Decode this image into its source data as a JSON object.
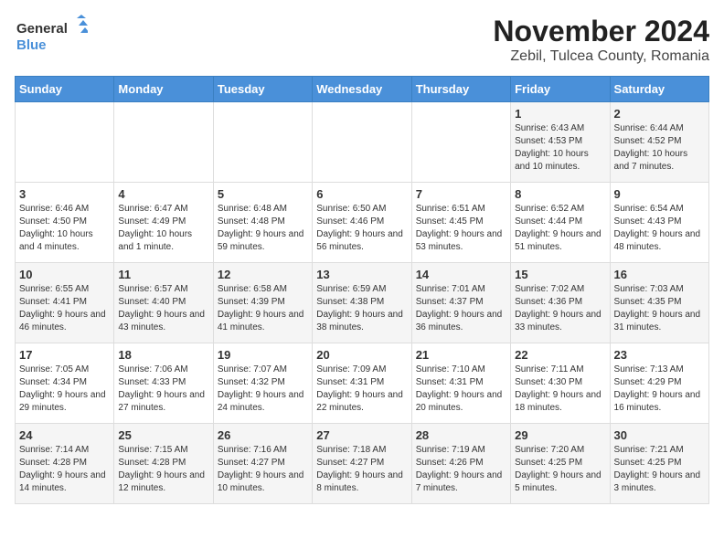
{
  "header": {
    "logo_line1": "General",
    "logo_line2": "Blue",
    "title": "November 2024",
    "subtitle": "Zebil, Tulcea County, Romania"
  },
  "weekdays": [
    "Sunday",
    "Monday",
    "Tuesday",
    "Wednesday",
    "Thursday",
    "Friday",
    "Saturday"
  ],
  "weeks": [
    [
      {
        "day": "",
        "info": ""
      },
      {
        "day": "",
        "info": ""
      },
      {
        "day": "",
        "info": ""
      },
      {
        "day": "",
        "info": ""
      },
      {
        "day": "",
        "info": ""
      },
      {
        "day": "1",
        "info": "Sunrise: 6:43 AM\nSunset: 4:53 PM\nDaylight: 10 hours and 10 minutes."
      },
      {
        "day": "2",
        "info": "Sunrise: 6:44 AM\nSunset: 4:52 PM\nDaylight: 10 hours and 7 minutes."
      }
    ],
    [
      {
        "day": "3",
        "info": "Sunrise: 6:46 AM\nSunset: 4:50 PM\nDaylight: 10 hours and 4 minutes."
      },
      {
        "day": "4",
        "info": "Sunrise: 6:47 AM\nSunset: 4:49 PM\nDaylight: 10 hours and 1 minute."
      },
      {
        "day": "5",
        "info": "Sunrise: 6:48 AM\nSunset: 4:48 PM\nDaylight: 9 hours and 59 minutes."
      },
      {
        "day": "6",
        "info": "Sunrise: 6:50 AM\nSunset: 4:46 PM\nDaylight: 9 hours and 56 minutes."
      },
      {
        "day": "7",
        "info": "Sunrise: 6:51 AM\nSunset: 4:45 PM\nDaylight: 9 hours and 53 minutes."
      },
      {
        "day": "8",
        "info": "Sunrise: 6:52 AM\nSunset: 4:44 PM\nDaylight: 9 hours and 51 minutes."
      },
      {
        "day": "9",
        "info": "Sunrise: 6:54 AM\nSunset: 4:43 PM\nDaylight: 9 hours and 48 minutes."
      }
    ],
    [
      {
        "day": "10",
        "info": "Sunrise: 6:55 AM\nSunset: 4:41 PM\nDaylight: 9 hours and 46 minutes."
      },
      {
        "day": "11",
        "info": "Sunrise: 6:57 AM\nSunset: 4:40 PM\nDaylight: 9 hours and 43 minutes."
      },
      {
        "day": "12",
        "info": "Sunrise: 6:58 AM\nSunset: 4:39 PM\nDaylight: 9 hours and 41 minutes."
      },
      {
        "day": "13",
        "info": "Sunrise: 6:59 AM\nSunset: 4:38 PM\nDaylight: 9 hours and 38 minutes."
      },
      {
        "day": "14",
        "info": "Sunrise: 7:01 AM\nSunset: 4:37 PM\nDaylight: 9 hours and 36 minutes."
      },
      {
        "day": "15",
        "info": "Sunrise: 7:02 AM\nSunset: 4:36 PM\nDaylight: 9 hours and 33 minutes."
      },
      {
        "day": "16",
        "info": "Sunrise: 7:03 AM\nSunset: 4:35 PM\nDaylight: 9 hours and 31 minutes."
      }
    ],
    [
      {
        "day": "17",
        "info": "Sunrise: 7:05 AM\nSunset: 4:34 PM\nDaylight: 9 hours and 29 minutes."
      },
      {
        "day": "18",
        "info": "Sunrise: 7:06 AM\nSunset: 4:33 PM\nDaylight: 9 hours and 27 minutes."
      },
      {
        "day": "19",
        "info": "Sunrise: 7:07 AM\nSunset: 4:32 PM\nDaylight: 9 hours and 24 minutes."
      },
      {
        "day": "20",
        "info": "Sunrise: 7:09 AM\nSunset: 4:31 PM\nDaylight: 9 hours and 22 minutes."
      },
      {
        "day": "21",
        "info": "Sunrise: 7:10 AM\nSunset: 4:31 PM\nDaylight: 9 hours and 20 minutes."
      },
      {
        "day": "22",
        "info": "Sunrise: 7:11 AM\nSunset: 4:30 PM\nDaylight: 9 hours and 18 minutes."
      },
      {
        "day": "23",
        "info": "Sunrise: 7:13 AM\nSunset: 4:29 PM\nDaylight: 9 hours and 16 minutes."
      }
    ],
    [
      {
        "day": "24",
        "info": "Sunrise: 7:14 AM\nSunset: 4:28 PM\nDaylight: 9 hours and 14 minutes."
      },
      {
        "day": "25",
        "info": "Sunrise: 7:15 AM\nSunset: 4:28 PM\nDaylight: 9 hours and 12 minutes."
      },
      {
        "day": "26",
        "info": "Sunrise: 7:16 AM\nSunset: 4:27 PM\nDaylight: 9 hours and 10 minutes."
      },
      {
        "day": "27",
        "info": "Sunrise: 7:18 AM\nSunset: 4:27 PM\nDaylight: 9 hours and 8 minutes."
      },
      {
        "day": "28",
        "info": "Sunrise: 7:19 AM\nSunset: 4:26 PM\nDaylight: 9 hours and 7 minutes."
      },
      {
        "day": "29",
        "info": "Sunrise: 7:20 AM\nSunset: 4:25 PM\nDaylight: 9 hours and 5 minutes."
      },
      {
        "day": "30",
        "info": "Sunrise: 7:21 AM\nSunset: 4:25 PM\nDaylight: 9 hours and 3 minutes."
      }
    ]
  ]
}
